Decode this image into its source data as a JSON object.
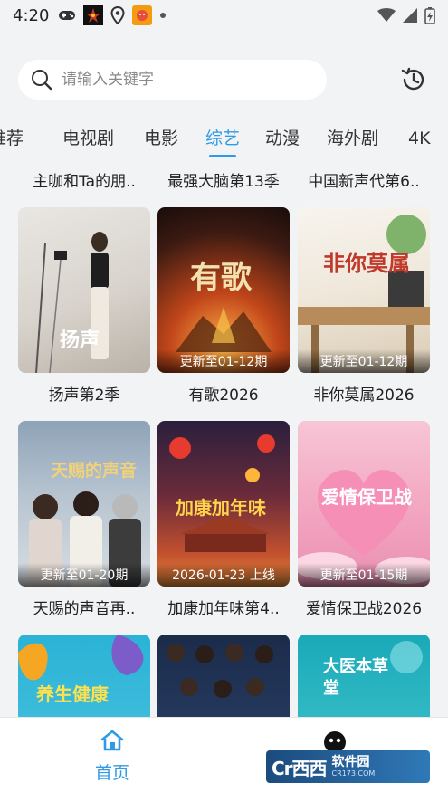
{
  "status_bar": {
    "time": "4:20"
  },
  "search": {
    "placeholder": "请输入关键字"
  },
  "tabs": [
    {
      "label": "推荐",
      "active": false
    },
    {
      "label": "电视剧",
      "active": false
    },
    {
      "label": "电影",
      "active": false
    },
    {
      "label": "综艺",
      "active": true
    },
    {
      "label": "动漫",
      "active": false
    },
    {
      "label": "海外剧",
      "active": false
    },
    {
      "label": "4K",
      "active": false
    }
  ],
  "prev_row_titles": [
    "主咖和Ta的朋..",
    "最强大脑第13季",
    "中国新声代第6.."
  ],
  "cards": [
    {
      "title": "扬声第2季",
      "tag": "",
      "poster_text": "扬声"
    },
    {
      "title": "有歌2026",
      "tag": "更新至01-12期",
      "poster_text": "有歌"
    },
    {
      "title": "非你莫属2026",
      "tag": "更新至01-12期",
      "poster_text": "非你莫属"
    },
    {
      "title": "天赐的声音再..",
      "tag": "更新至01-20期",
      "poster_text": "天赐的声音"
    },
    {
      "title": "加康加年味第4..",
      "tag": "2026-01-23 上线",
      "poster_text": "加康加年味"
    },
    {
      "title": "爱情保卫战2026",
      "tag": "更新至01-15期",
      "poster_text": "爱情保卫战"
    },
    {
      "title": "",
      "tag": "",
      "poster_text": "养生健康"
    },
    {
      "title": "",
      "tag": "",
      "poster_text": ""
    },
    {
      "title": "",
      "tag": "",
      "poster_text": "大医本草堂"
    }
  ],
  "bottom_nav": {
    "home_label": "首页"
  },
  "watermark": {
    "logo": "Cr西西",
    "name": "软件园",
    "url": "CR173.COM"
  },
  "colors": {
    "accent": "#2f9be8",
    "background": "#f2f3f5"
  }
}
